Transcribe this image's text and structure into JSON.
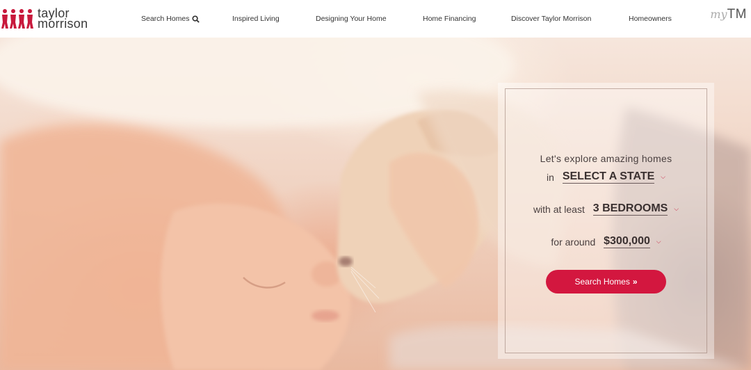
{
  "brand": {
    "name_line1": "taylor",
    "name_line2": "morrison",
    "color": "#c8193c"
  },
  "nav": {
    "items": [
      {
        "label": "Search Homes",
        "icon": "search-icon"
      },
      {
        "label": "Inspired Living"
      },
      {
        "label": "Designing Your Home"
      },
      {
        "label": "Home Financing"
      },
      {
        "label": "Discover Taylor Morrison"
      },
      {
        "label": "Homeowners"
      }
    ],
    "account": {
      "prefix": "my",
      "label": "TM"
    }
  },
  "search_card": {
    "intro": "Let's explore amazing homes",
    "state_prefix": "in",
    "state_value": "SELECT A STATE",
    "bedrooms_prefix": "with at least",
    "bedrooms_value": "3 BEDROOMS",
    "price_prefix": "for around",
    "price_value": "$300,000",
    "button_label": "Search Homes",
    "button_arrow": "»",
    "button_color": "#d3173f"
  }
}
